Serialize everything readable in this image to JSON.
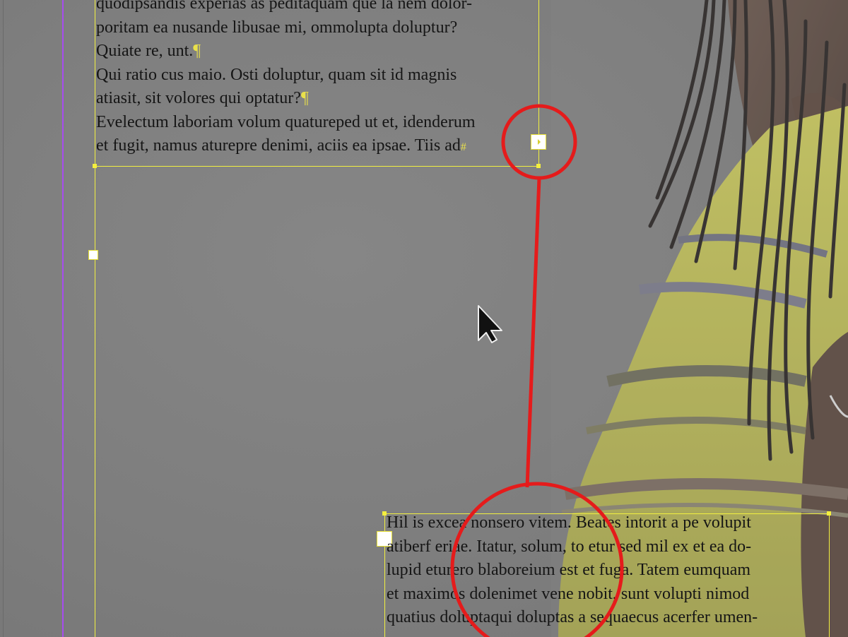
{
  "document": {
    "top_frame_lines": [
      "quodipsandis experias as peditaquam que la nem dolor-",
      "poritam ea nusande libusae mi, ommolupta doluptur?",
      "Quiate re, unt.",
      "Qui ratio cus maio. Osti doluptur, quam sit id magnis",
      "atiasit, sit volores qui optatur?",
      "Evelectum laboriam volum quatureped ut et, idenderum",
      "et fugit, namus aturepre denimi, aciis ea ipsae. Tiis ad"
    ],
    "bottom_frame_lines": [
      "Hil is excea nonsero vitem. Beates intorit a pe volupit",
      "atiberf eriae. Itatur, solum, to etur sed mil ex et ea do-",
      "lupid eturero blaboreium est et fuga. Tatem eumquam",
      "et maximos dolenimet vene nobit, sunt volupti nimod",
      "quatius doluptaqui doluptas a sequaecus acerfer umen-"
    ],
    "pilcrow": "¶",
    "end_marker": "#"
  },
  "colors": {
    "frame_edge": "#f2f040",
    "margin_guide": "#a74cf0",
    "annotation": "#e51b1b",
    "pasteboard": "#7e7e7e"
  },
  "icons": {
    "cursor": "arrow-pointer-icon",
    "out_port": "overset-out-port-icon",
    "in_port": "in-port-icon"
  }
}
